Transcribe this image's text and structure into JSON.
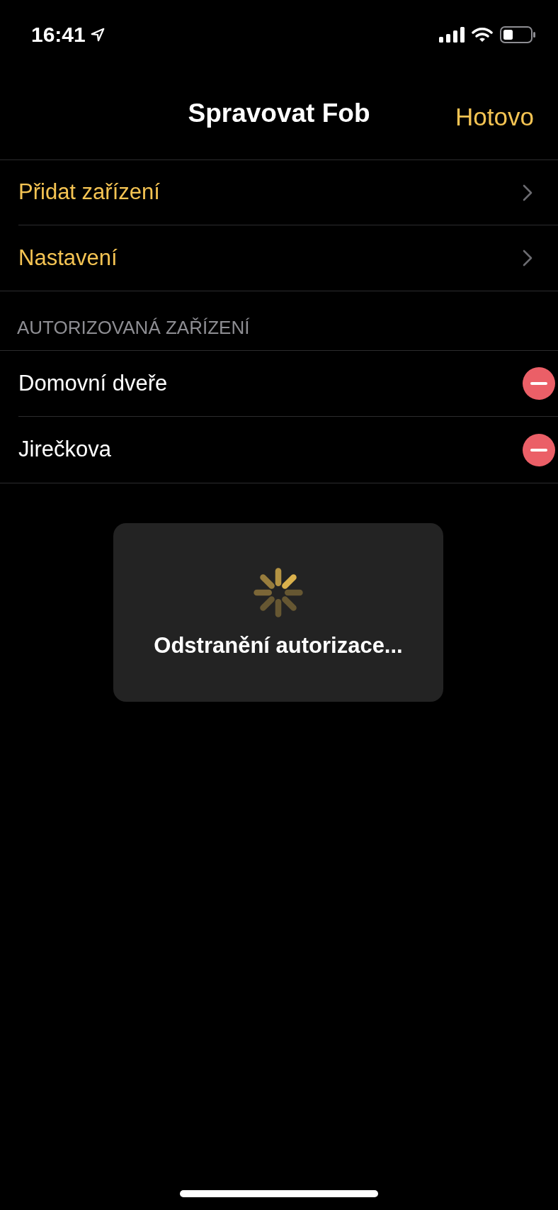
{
  "status_bar": {
    "time": "16:41"
  },
  "nav": {
    "title": "Spravovat Fob",
    "done": "Hotovo"
  },
  "menu_items": [
    {
      "label": "Přidat zařízení"
    },
    {
      "label": "Nastavení"
    }
  ],
  "section": {
    "header": "AUTORIZOVANÁ ZAŘÍZENÍ",
    "devices": [
      {
        "name": "Domovní dveře"
      },
      {
        "name": "Jirečkova"
      }
    ]
  },
  "hud": {
    "message": "Odstranění autorizace..."
  }
}
